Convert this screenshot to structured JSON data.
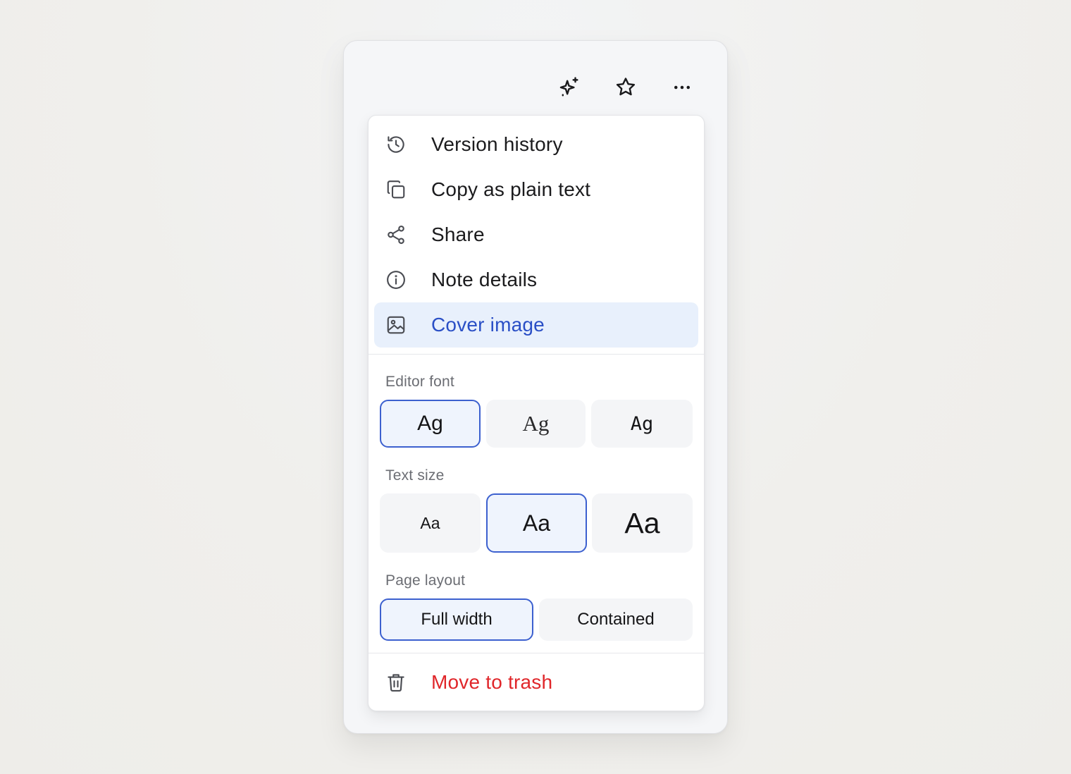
{
  "toolbar": {
    "icons": [
      "sparkles-icon",
      "star-icon",
      "more-horizontal-icon"
    ]
  },
  "menu": {
    "items": [
      {
        "label": "Version history",
        "icon": "history-icon"
      },
      {
        "label": "Copy as plain text",
        "icon": "copy-icon"
      },
      {
        "label": "Share",
        "icon": "share-icon"
      },
      {
        "label": "Note details",
        "icon": "info-icon"
      },
      {
        "label": "Cover image",
        "icon": "image-icon",
        "active": true
      }
    ],
    "editor_font": {
      "label": "Editor font",
      "options": [
        {
          "sample": "Ag",
          "style": "sans",
          "selected": true
        },
        {
          "sample": "Ag",
          "style": "serif",
          "selected": false
        },
        {
          "sample": "Ag",
          "style": "mono",
          "selected": false
        }
      ]
    },
    "text_size": {
      "label": "Text size",
      "options": [
        {
          "sample": "Aa",
          "size": "small",
          "selected": false
        },
        {
          "sample": "Aa",
          "size": "medium",
          "selected": true
        },
        {
          "sample": "Aa",
          "size": "large",
          "selected": false
        }
      ]
    },
    "page_layout": {
      "label": "Page layout",
      "options": [
        {
          "label": "Full width",
          "selected": true
        },
        {
          "label": "Contained",
          "selected": false
        }
      ]
    },
    "trash": {
      "label": "Move to trash",
      "icon": "trash-icon"
    }
  },
  "colors": {
    "accent": "#3c60cf",
    "accent_text": "#2a4fc6",
    "active_bg": "#e8f0fc",
    "danger": "#e0262a"
  }
}
